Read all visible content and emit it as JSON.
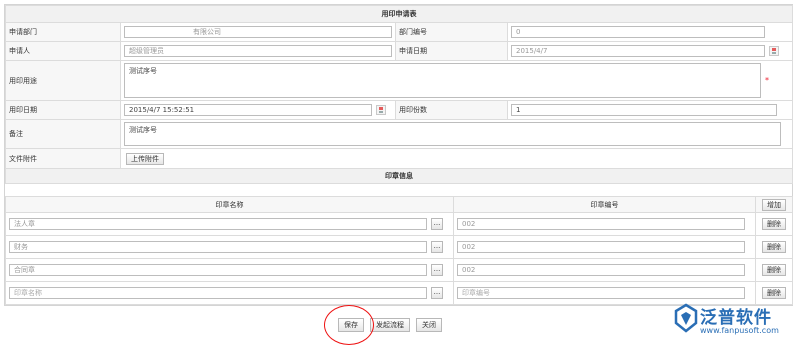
{
  "form": {
    "title": "用印申请表",
    "dept_label": "申请部门",
    "dept_value": "有限公司",
    "dept_no_label": "部门编号",
    "dept_no_value": "0",
    "applicant_label": "申请人",
    "applicant_value": "超级管理员",
    "apply_date_label": "申请日期",
    "apply_date_value": "2015/4/7",
    "purpose_label": "用印用途",
    "purpose_value": "测试序号",
    "use_date_label": "用印日期",
    "use_date_value": "2015/4/7 15:52:51",
    "copies_label": "用印份数",
    "copies_value": "1",
    "remark_label": "备注",
    "remark_value": "测试序号",
    "attach_label": "文件附件",
    "upload_button": "上传附件"
  },
  "seals": {
    "title": "印章信息",
    "col_name": "印章名称",
    "col_no": "印章编号",
    "add_button": "增加",
    "browse_label": "...",
    "delete_button": "删除",
    "rows": [
      {
        "name": "法人章",
        "no": "002",
        "name_placeholder": false,
        "no_placeholder": false
      },
      {
        "name": "财务",
        "no": "002",
        "name_placeholder": false,
        "no_placeholder": false
      },
      {
        "name": "合同章",
        "no": "002",
        "name_placeholder": false,
        "no_placeholder": false
      },
      {
        "name": "印章名称",
        "no": "印章编号",
        "name_placeholder": true,
        "no_placeholder": true
      }
    ]
  },
  "footer": {
    "save": "保存",
    "start_flow": "发起流程",
    "close": "关闭"
  },
  "brand": {
    "name": "泛普软件",
    "url": "www.fanpusoft.com",
    "color": "#2a6eb5"
  },
  "colors": {
    "highlight_circle": "#ee1111"
  }
}
